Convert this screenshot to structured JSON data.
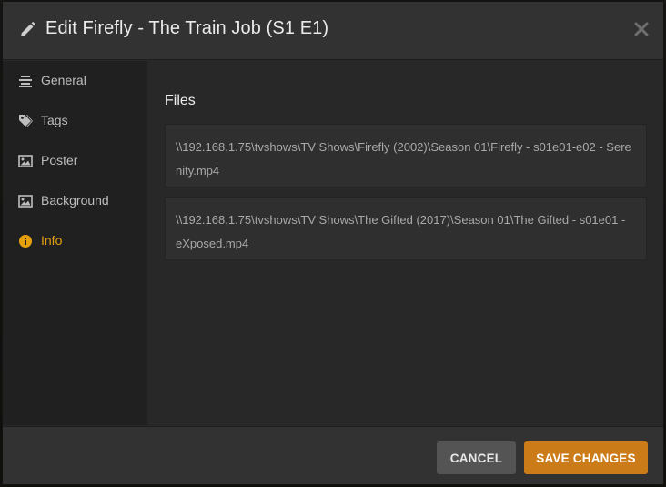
{
  "dialog": {
    "title": "Edit Firefly - The Train Job (S1 E1)",
    "header_icon": "pencil-icon",
    "close_icon": "close-icon"
  },
  "sidebar": {
    "items": [
      {
        "label": "General",
        "icon": "list-icon",
        "active": false
      },
      {
        "label": "Tags",
        "icon": "tags-icon",
        "active": false
      },
      {
        "label": "Poster",
        "icon": "image-icon",
        "active": false
      },
      {
        "label": "Background",
        "icon": "image-icon",
        "active": false
      },
      {
        "label": "Info",
        "icon": "info-icon",
        "active": true
      }
    ]
  },
  "main": {
    "section_title": "Files",
    "files": [
      "\\\\192.168.1.75\\tvshows\\TV Shows\\Firefly (2002)\\Season 01\\Firefly - s01e01-e02 - Serenity.mp4",
      "\\\\192.168.1.75\\tvshows\\TV Shows\\The Gifted (2017)\\Season 01\\The Gifted - s01e01 - eXposed.mp4"
    ]
  },
  "footer": {
    "cancel_label": "CANCEL",
    "save_label": "SAVE CHANGES"
  },
  "colors": {
    "accent": "#e5a00d",
    "save_button": "#cc7b19",
    "cancel_button": "#545454",
    "header_bg": "#323232",
    "sidebar_bg": "#202020",
    "content_bg": "#282828"
  }
}
